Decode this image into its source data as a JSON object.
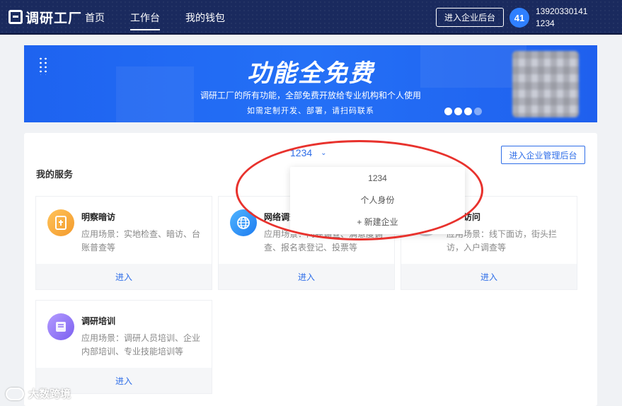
{
  "app": {
    "logo_text": "调研工厂",
    "nav": [
      "首页",
      "工作台",
      "我的钱包"
    ],
    "active_nav": "工作台",
    "enterprise_button": "进入企业后台",
    "avatar_text": "41",
    "user_phone": "13920330141",
    "user_org": "1234"
  },
  "banner": {
    "title": "功能全免费",
    "line1": "调研工厂的所有功能，全部免费开放给专业机构和个人使用",
    "line2": "如需定制开发、部署，请扫码联系"
  },
  "workspace": {
    "org_selected": "1234",
    "admin_button": "进入企业管理后台",
    "section_title": "我的服务",
    "org_dropdown": [
      "1234",
      "个人身份",
      "+ 新建企业"
    ]
  },
  "services": [
    {
      "name": "明察暗访",
      "desc": "应用场景：实地检查、暗访、台账普查等",
      "enter": "进入",
      "icon": "clipboard-icon",
      "color": "#f5a536"
    },
    {
      "name": "网络调查",
      "desc": "应用场景：问卷调查、满意度调查、报名表登记、投票等",
      "enter": "进入",
      "icon": "globe-icon",
      "color": "#2b8cf5"
    },
    {
      "name": "入户访问",
      "desc": "应用场景：线下面访，街头拦访，入户调查等",
      "enter": "进入",
      "icon": "interview-icon",
      "color": "#c8ccd4"
    },
    {
      "name": "调研培训",
      "desc": "应用场景：调研人员培训、企业内部培训、专业技能培训等",
      "enter": "进入",
      "icon": "book-icon",
      "color": "#8c6ff4"
    }
  ],
  "watermark": "大数跨境"
}
